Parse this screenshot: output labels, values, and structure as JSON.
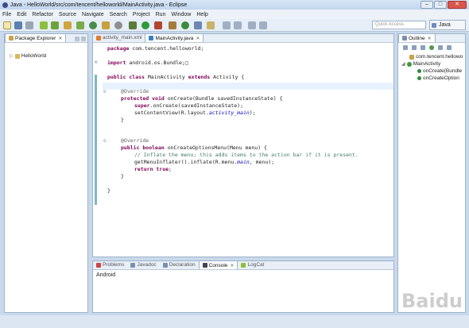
{
  "window": {
    "title": "Java - HelloWorld/src/com/tencent/helloworld/MainActivity.java - Eclipse",
    "min": "–",
    "max": "□",
    "close": "✕"
  },
  "menu": [
    "File",
    "Edit",
    "Refactor",
    "Source",
    "Navigate",
    "Search",
    "Project",
    "Run",
    "Window",
    "Help"
  ],
  "toolbar": {
    "quick_access_placeholder": "Quick Access",
    "perspective_label": "Java"
  },
  "package_explorer": {
    "tab_label": "Package Explorer",
    "close": "✕",
    "tree": [
      {
        "label": "HelloWorld",
        "expander": "▷"
      }
    ]
  },
  "editor": {
    "tabs": [
      {
        "label": "activity_main.xml",
        "active": false
      },
      {
        "label": "MainActivity.java",
        "active": true
      }
    ],
    "close": "✕",
    "code": {
      "l1": {
        "kw": "package",
        "rest": " com.tencent.helloworld;"
      },
      "l2": {
        "kw": "import",
        "rest": " android.os.Bundle;□"
      },
      "l3": {
        "kw1": "public class",
        "mid": " MainActivity ",
        "kw2": "extends",
        "rest": " Activity {"
      },
      "l4": {
        "an": "@Override"
      },
      "l5": {
        "kw": "protected void",
        "rest": " onCreate(Bundle savedInstanceState) {"
      },
      "l6": {
        "kw": "super",
        "rest": ".onCreate(savedInstanceState);"
      },
      "l7": {
        "pre": "setContentView(R.layout.",
        "fi": "activity_main",
        "post": ");"
      },
      "l8": "}",
      "l9": {
        "an": "@Override"
      },
      "l10": {
        "kw": "public boolean",
        "rest": " onCreateOptionsMenu(Menu menu) {"
      },
      "l11": {
        "cm": "// Inflate the menu; this adds items to the action bar if it is present."
      },
      "l12": {
        "pre": "getMenuInflater().inflate(R.menu.",
        "fi": "main",
        "post": ", menu);"
      },
      "l13": {
        "kw": "return true",
        "rest": ";"
      },
      "l14": "}",
      "l15": "}",
      "fold_minus": "⊖",
      "fold_plus": "⊕"
    }
  },
  "outline": {
    "tab_label": "Outline",
    "close": "✕",
    "items": [
      {
        "label": "com.tencent.hellowo"
      },
      {
        "label": "MainActivity"
      },
      {
        "label": "onCreate(Bundle"
      },
      {
        "label": "onCreateOption"
      }
    ]
  },
  "bottom_panel": {
    "tabs": [
      {
        "label": "Problems",
        "active": false
      },
      {
        "label": "Javadoc",
        "active": false
      },
      {
        "label": "Declaration",
        "active": false
      },
      {
        "label": "Console",
        "active": true
      },
      {
        "label": "LogCat",
        "active": false
      }
    ],
    "close": "✕",
    "console_text": "Android"
  },
  "watermark": "Baidu",
  "colors": {
    "keyword": "#7f0055",
    "annotation": "#646464",
    "comment": "#3f7f5f",
    "field": "#0000c0",
    "window_bg": "#c9d9ec"
  }
}
